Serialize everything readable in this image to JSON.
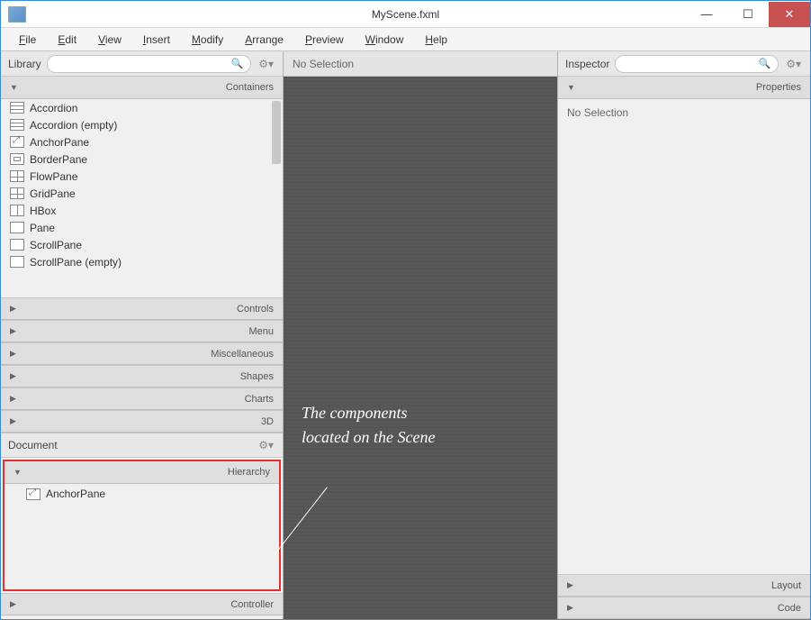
{
  "window": {
    "title": "MyScene.fxml"
  },
  "menu": {
    "items": [
      {
        "label": "File",
        "u": "F",
        "rest": "ile"
      },
      {
        "label": "Edit",
        "u": "E",
        "rest": "dit"
      },
      {
        "label": "View",
        "u": "V",
        "rest": "iew"
      },
      {
        "label": "Insert",
        "u": "I",
        "rest": "nsert"
      },
      {
        "label": "Modify",
        "u": "M",
        "rest": "odify"
      },
      {
        "label": "Arrange",
        "u": "A",
        "rest": "rrange"
      },
      {
        "label": "Preview",
        "u": "P",
        "rest": "review"
      },
      {
        "label": "Window",
        "u": "W",
        "rest": "indow"
      },
      {
        "label": "Help",
        "u": "H",
        "rest": "elp"
      }
    ]
  },
  "library": {
    "title": "Library",
    "sections": {
      "containers": "Containers",
      "controls": "Controls",
      "menu": "Menu",
      "misc": "Miscellaneous",
      "shapes": "Shapes",
      "charts": "Charts",
      "threeD": "3D"
    },
    "items": [
      {
        "name": "Accordion",
        "icon": "stack"
      },
      {
        "name": "Accordion  (empty)",
        "icon": "stack"
      },
      {
        "name": "AnchorPane",
        "icon": "anchor"
      },
      {
        "name": "BorderPane",
        "icon": "border"
      },
      {
        "name": "FlowPane",
        "icon": "grid"
      },
      {
        "name": "GridPane",
        "icon": "grid"
      },
      {
        "name": "HBox",
        "icon": "hbox"
      },
      {
        "name": "Pane",
        "icon": "plain"
      },
      {
        "name": "ScrollPane",
        "icon": "plain"
      },
      {
        "name": "ScrollPane  (empty)",
        "icon": "plain"
      }
    ]
  },
  "document": {
    "title": "Document",
    "hierarchy_label": "Hierarchy",
    "controller_label": "Controller",
    "root_node": "AnchorPane"
  },
  "center": {
    "status": "No Selection",
    "annotation_line1": "The components",
    "annotation_line2": "located on the Scene"
  },
  "inspector": {
    "title": "Inspector",
    "properties_label": "Properties",
    "layout_label": "Layout",
    "code_label": "Code",
    "body_text": "No Selection"
  }
}
